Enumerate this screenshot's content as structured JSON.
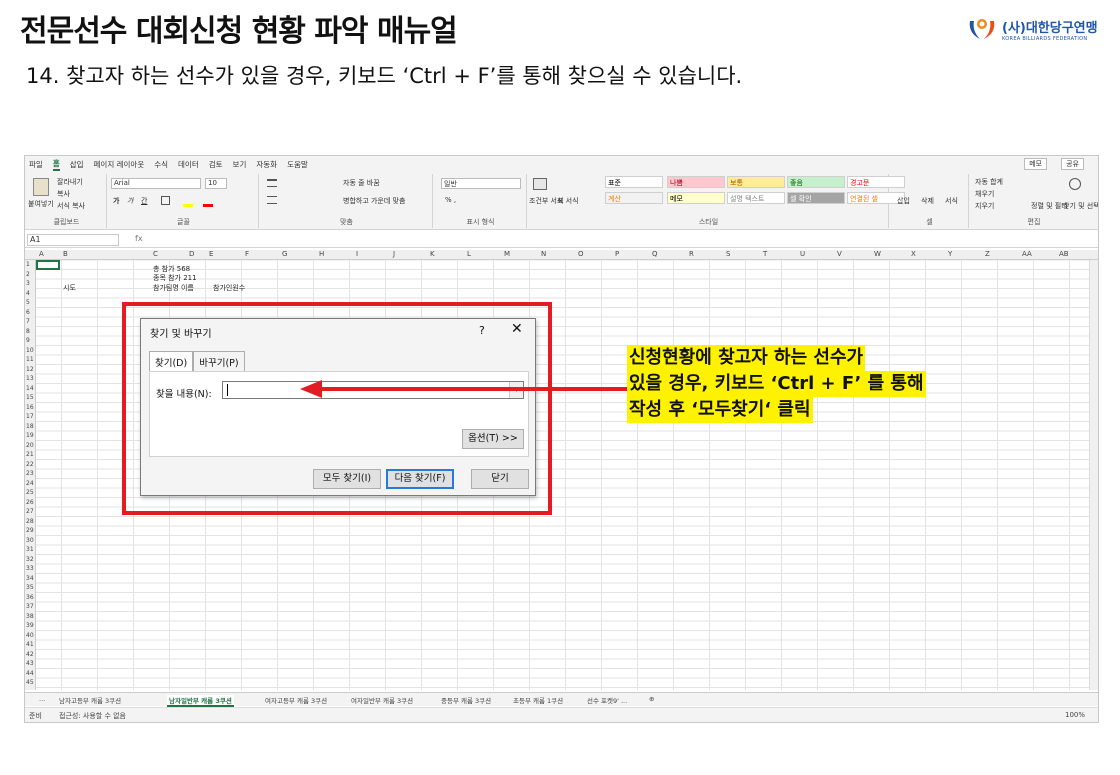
{
  "slide": {
    "title": "전문선수 대회신청 현황 파악 매뉴얼",
    "subtitle": "14. 찾고자 하는 선수가 있을 경우, 키보드 ‘Ctrl + F’를 통해 찾으실 수 있습니다.",
    "logo_kr": "(사)대한당구연맹",
    "logo_en": "KOREA BILLIARDS FEDERATION"
  },
  "excel": {
    "menu": [
      "파일",
      "홈",
      "삽입",
      "페이지 레이아웃",
      "수식",
      "데이터",
      "검토",
      "보기",
      "자동화",
      "도움말"
    ],
    "menu_right": [
      "메모",
      "공유"
    ],
    "ribbon": {
      "clipboard": {
        "paste": "붙여넣기",
        "cut": "잘라내기",
        "copy": "복사",
        "format_painter": "서식 복사",
        "label": "클립보드"
      },
      "font": {
        "name": "Arial",
        "size": "10",
        "label": "글꼴"
      },
      "alignment": {
        "wrap": "자동 줄 바꿈",
        "merge": "병합하고 가운데 맞춤",
        "label": "맞춤"
      },
      "number": {
        "format": "일반",
        "label": "표시 형식"
      },
      "styles": {
        "conditional": "조건부 서식",
        "table": "표 서식",
        "cells": [
          {
            "text": "표준",
            "bg": "#ffffff",
            "color": "#000000"
          },
          {
            "text": "나쁨",
            "bg": "#ffc7ce",
            "color": "#9c0006"
          },
          {
            "text": "보통",
            "bg": "#ffeb9c",
            "color": "#9c5700"
          },
          {
            "text": "좋음",
            "bg": "#c6efce",
            "color": "#006100"
          },
          {
            "text": "경고문",
            "bg": "#ffffff",
            "color": "#ff0000"
          },
          {
            "text": "계산",
            "bg": "#f2f2f2",
            "color": "#fa7d00"
          },
          {
            "text": "메모",
            "bg": "#ffffcc",
            "color": "#000000"
          },
          {
            "text": "설명 텍스트",
            "bg": "#ffffff",
            "color": "#7f7f7f"
          },
          {
            "text": "셀 확인",
            "bg": "#a5a5a5",
            "color": "#ffffff"
          },
          {
            "text": "연결된 셀",
            "bg": "#ffffff",
            "color": "#fa7d00"
          }
        ],
        "label": "스타일"
      },
      "cells": {
        "insert": "삽입",
        "delete": "삭제",
        "format": "서식",
        "label": "셀"
      },
      "editing": {
        "autosum": "자동 합계",
        "fill": "채우기",
        "clear": "지우기",
        "sort": "정렬 및 필터",
        "find": "찾기 및 선택",
        "label": "편집"
      }
    },
    "name_box": "A1",
    "fx": "fx",
    "columns": [
      "A",
      "B",
      "C",
      "D",
      "E",
      "F",
      "G",
      "H",
      "I",
      "J",
      "K",
      "L",
      "M",
      "N",
      "O",
      "P",
      "Q",
      "R",
      "S",
      "T",
      "U",
      "V",
      "W",
      "X",
      "Y",
      "Z",
      "AA",
      "AB"
    ],
    "cells": {
      "c1": "총 참가 568",
      "c2": "종목 참가 211",
      "b3": "시도",
      "c3": "참가팀명 이름",
      "e3": "참가인원수"
    },
    "sheet_tabs": [
      "...",
      "남자고등부 캐롬 3쿠션",
      "남자일반부 캐롬 3쿠션",
      "여자고등부 캐롬 3쿠션",
      "여자일반부 캐롬 3쿠션",
      "중등부 캐롬 3쿠션",
      "초등부 캐롬 1쿠션",
      "선수 포켓9' ..."
    ],
    "active_tab_index": 2,
    "status": {
      "ready": "준비",
      "accessibility": "접근성: 사용할 수 없음",
      "zoom": "100%"
    }
  },
  "dialog": {
    "title": "찾기 및 바꾸기",
    "help": "?",
    "close": "✕",
    "tab_find": "찾기(D)",
    "tab_replace": "바꾸기(P)",
    "find_label": "찾을 내용(N):",
    "find_value": "",
    "options": "옵션(T) >>",
    "find_all": "모두 찾기(I)",
    "find_next": "다음 찾기(F)",
    "close_btn": "닫기"
  },
  "callout": {
    "line1": "신청현황에 찾고자 하는 선수가",
    "line2": "있을 경우, 키보드 ‘Ctrl + F’ 를 통해",
    "line3": "작성 후 ‘모두찾기‘ 클릭"
  },
  "colors": {
    "highlight": "#fff200",
    "annotation_red": "#e31c23",
    "excel_green": "#217346"
  }
}
